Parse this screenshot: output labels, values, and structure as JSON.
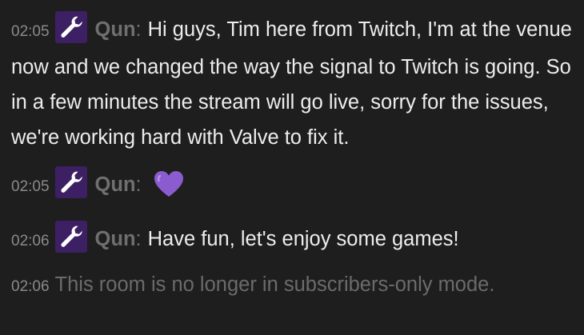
{
  "colors": {
    "background": "#1e1e1e",
    "timestamp": "#8a8a8a",
    "username": "#6f6f6f",
    "message": "#ededed",
    "system_message": "#6b6b6b",
    "badge": "#3d1f63",
    "heart_emote": "#8a5ccf"
  },
  "messages": [
    {
      "time": "02:05",
      "badge_icon": "wrench-icon",
      "username": "Qun",
      "colon": ":",
      "text": "Hi guys, Tim here from Twitch, I'm at the venue now and we changed the way the signal to Twitch is going. So in a few minutes the stream will go live, sorry for the issues, we're working hard with Valve to fix it."
    },
    {
      "time": "02:05",
      "badge_icon": "wrench-icon",
      "username": "Qun",
      "colon": ":",
      "emote": "purple-heart-icon"
    },
    {
      "time": "02:06",
      "badge_icon": "wrench-icon",
      "username": "Qun",
      "colon": ":",
      "text": "Have fun, let's enjoy some games!"
    }
  ],
  "system": {
    "time": "02:06",
    "text": "This room is no longer in subscribers-only mode."
  }
}
